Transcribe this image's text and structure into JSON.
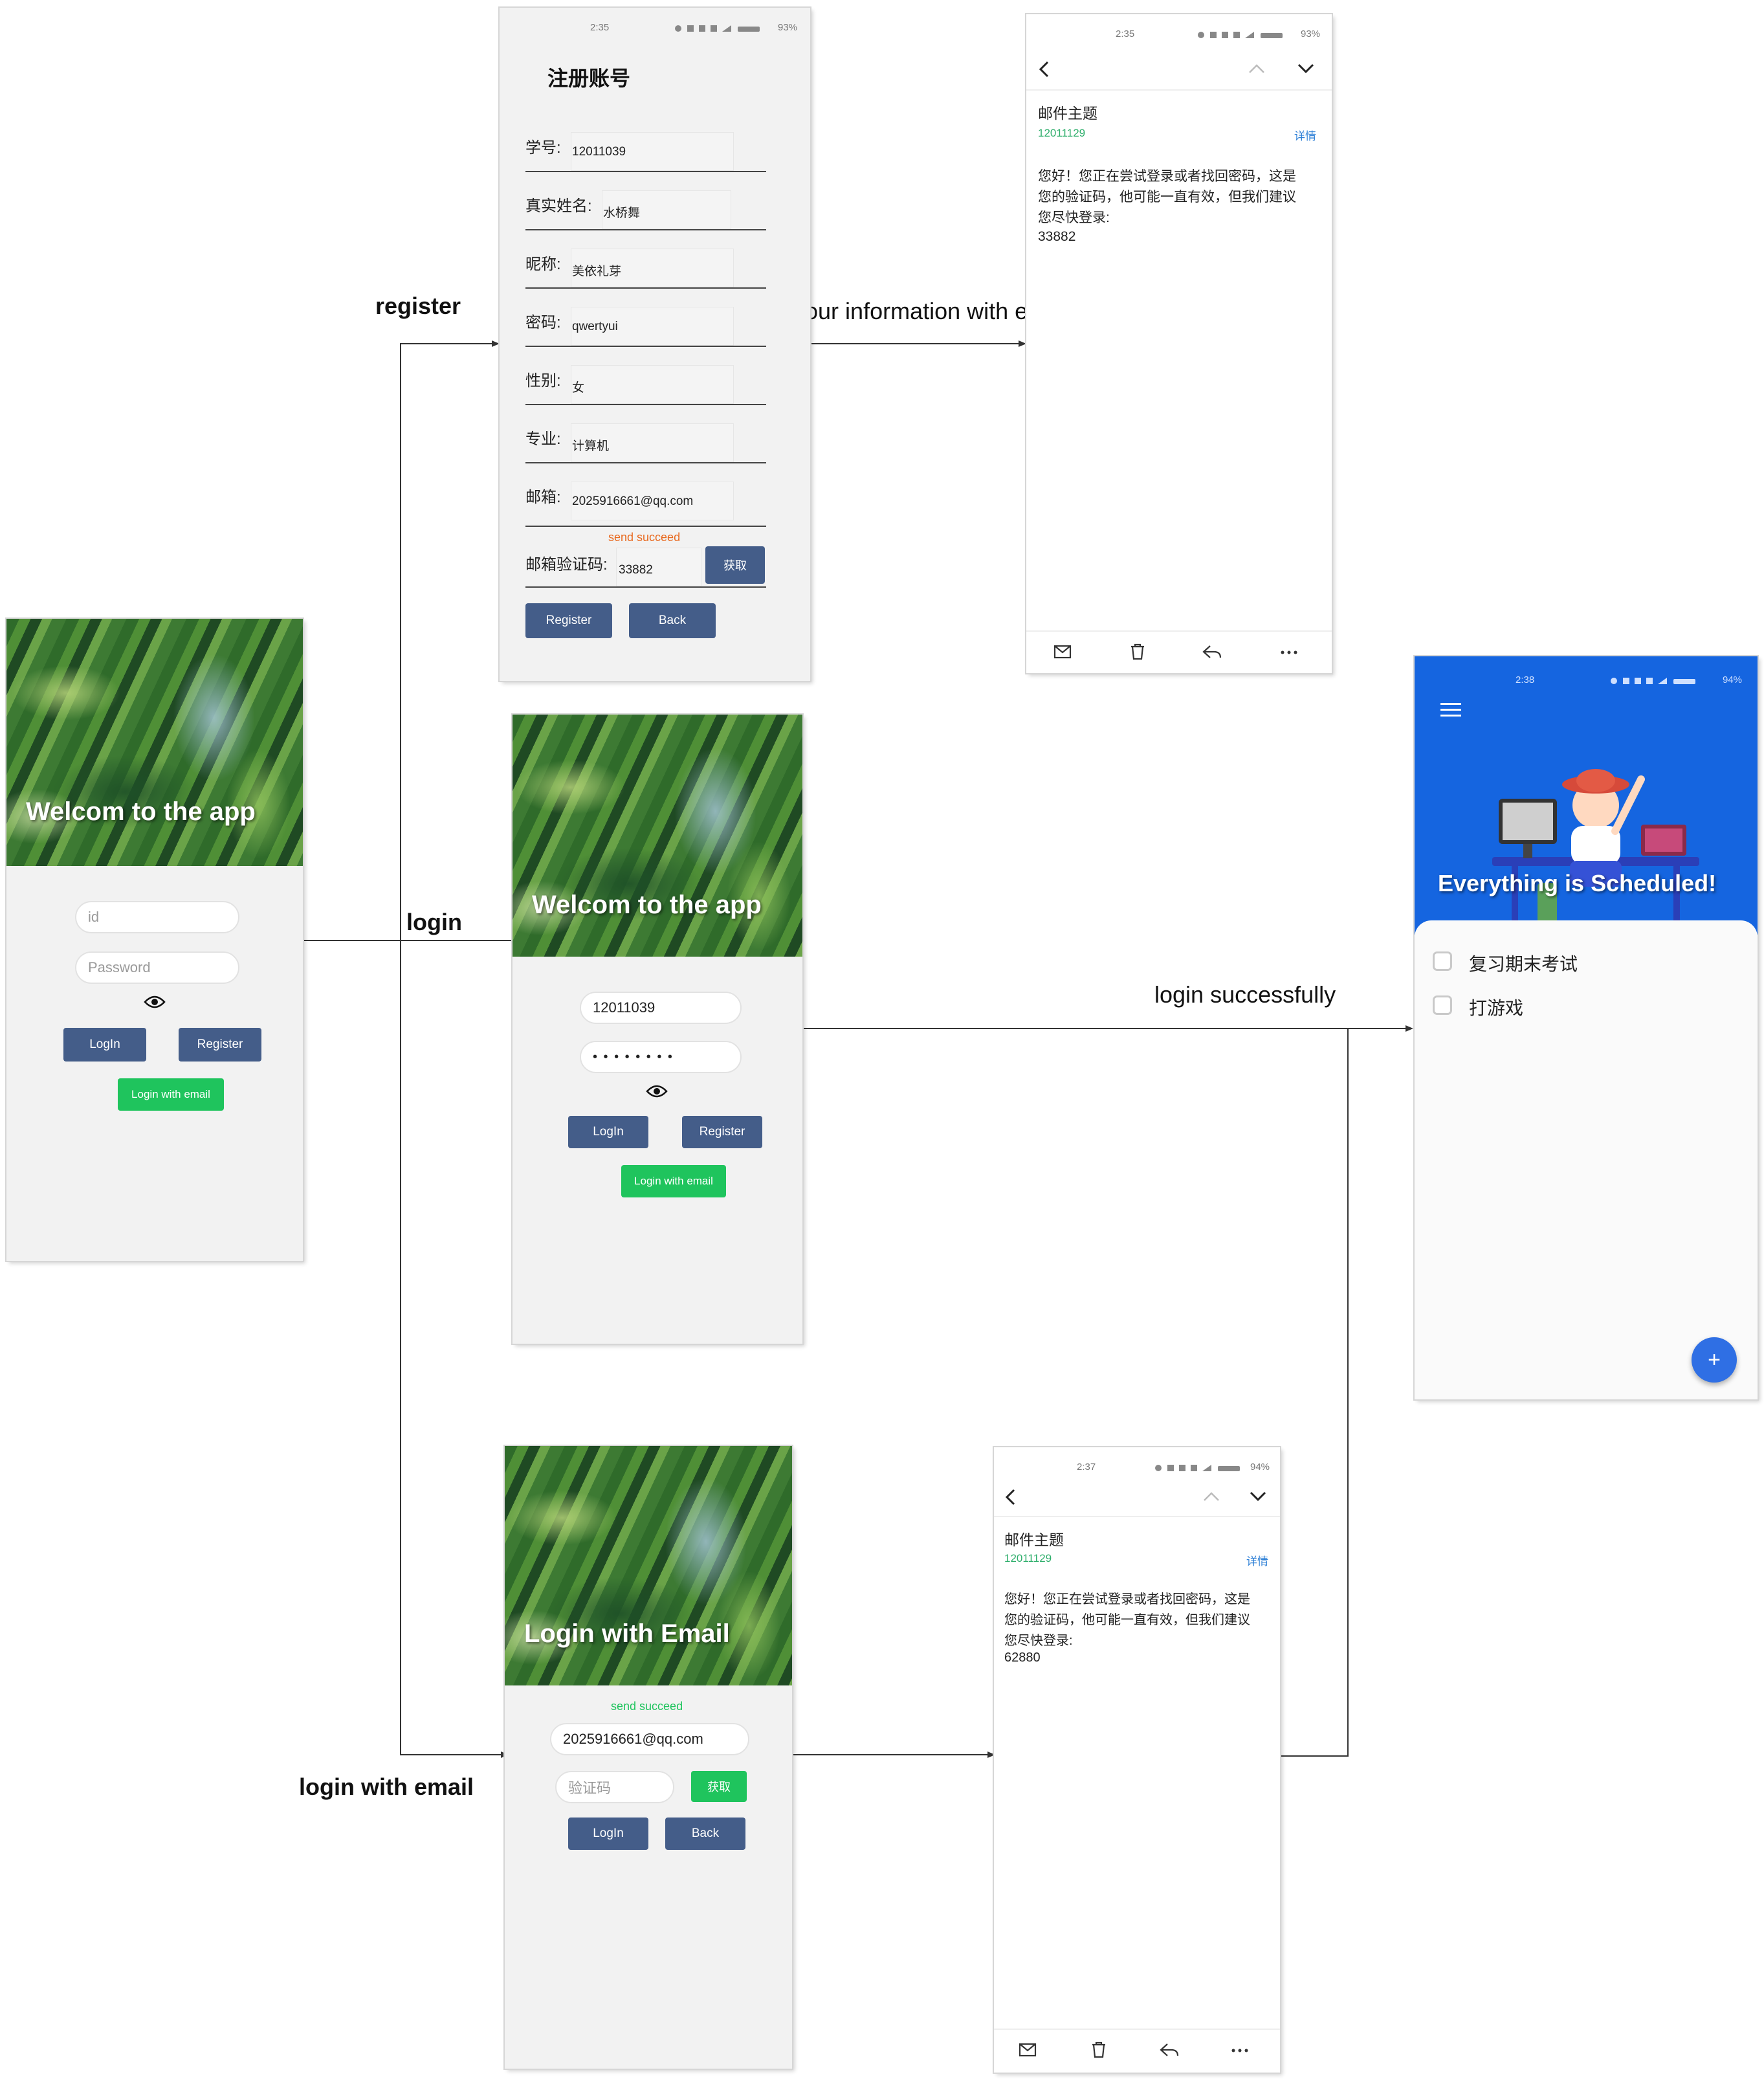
{
  "annotations": {
    "register": "register",
    "verify": "verify your information with email",
    "login": "login",
    "login_success": "login successfully",
    "login_email": "login with email"
  },
  "login_empty": {
    "title": "Welcom to the app",
    "id_placeholder": "id",
    "password_placeholder": "Password",
    "login_btn": "LogIn",
    "register_btn": "Register",
    "email_btn": "Login with email"
  },
  "login_filled": {
    "title": "Welcom to the app",
    "id_value": "12011039",
    "password_value": "• • • • • • • •",
    "login_btn": "LogIn",
    "register_btn": "Register",
    "email_btn": "Login with email"
  },
  "register_screen": {
    "status": "2:35",
    "battery": "93%",
    "title": "注册账号",
    "fields": [
      {
        "label": "学号:",
        "value": "12011039"
      },
      {
        "label": "真实姓名:",
        "value": "水桥舞"
      },
      {
        "label": "昵称:",
        "value": "美依礼芽"
      },
      {
        "label": "密码:",
        "value": "qwertyui"
      },
      {
        "label": "性别:",
        "value": "女"
      },
      {
        "label": "专业:",
        "value": "计算机"
      },
      {
        "label": "邮箱:",
        "value": "2025916661@qq.com"
      }
    ],
    "send_status": "send succeed",
    "code_label": "邮箱验证码:",
    "code_value": "33882",
    "get_btn": "获取",
    "register_btn": "Register",
    "back_btn": "Back"
  },
  "mail_top": {
    "status": "2:35",
    "battery": "93%",
    "subject": "邮件主题",
    "sender": "12011129",
    "detail": "详情",
    "body": [
      "您好！您正在尝试登录或者找回密码，这是",
      "您的验证码，他可能一直有效，但我们建议",
      "您尽快登录:"
    ],
    "code": "33882"
  },
  "email_login": {
    "title": "Login with Email",
    "send_status": "send succeed",
    "email_value": "2025916661@qq.com",
    "code_placeholder": "验证码",
    "get_btn": "获取",
    "login_btn": "LogIn",
    "back_btn": "Back"
  },
  "mail_bottom": {
    "status": "2:37",
    "battery": "94%",
    "subject": "邮件主题",
    "sender": "12011129",
    "detail": "详情",
    "body": [
      "您好！您正在尝试登录或者找回密码，这是",
      "您的验证码，他可能一直有效，但我们建议",
      "您尽快登录:"
    ],
    "code": "62880"
  },
  "todo": {
    "status": "2:38",
    "battery": "94%",
    "headline": "Everything is Scheduled!",
    "tasks": [
      "复习期末考试",
      "打游戏"
    ],
    "fab": "+",
    "colors": {
      "header": "#1565e0",
      "fab": "#2f6fe4"
    }
  },
  "colors": {
    "navy": "#445d89",
    "green": "#1fc45d",
    "link_blue": "#2d7fd6",
    "sender_green": "#2eae6b",
    "send_orange": "#e8691f"
  }
}
